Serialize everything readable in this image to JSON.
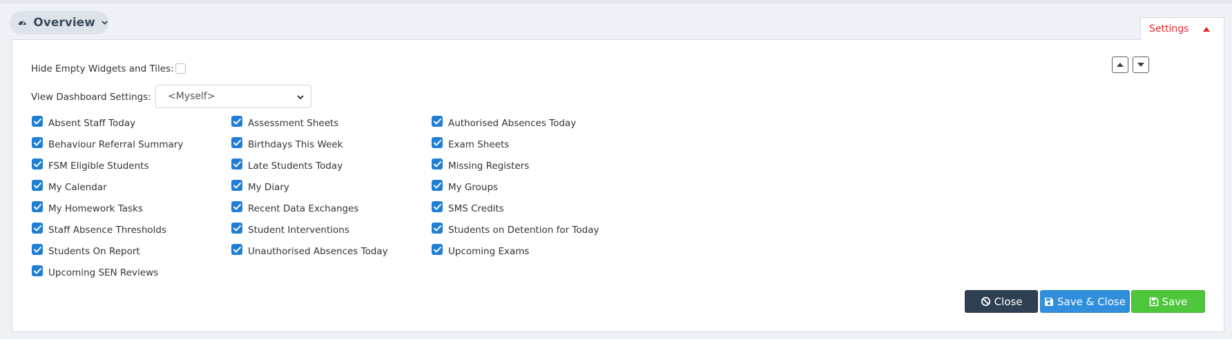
{
  "header": {
    "title": "Overview",
    "icons": {
      "dashboard": "gauge-icon",
      "dropdown": "chevron-down-icon"
    }
  },
  "toolbar": {
    "move_up_icon": "arrow-up-icon",
    "move_down_icon": "arrow-down-icon",
    "settings_tab_label": "Settings",
    "settings_tab_color": "#e8242b"
  },
  "settings": {
    "hide_empty_label": "Hide Empty Widgets and Tiles:",
    "hide_empty_checked": false,
    "view_dashboard_label": "View Dashboard Settings:",
    "view_dashboard_value": "<Myself>",
    "check_color": "#1f7fd6",
    "widgets": [
      {
        "label": "Absent Staff Today",
        "checked": true
      },
      {
        "label": "Behaviour Referral Summary",
        "checked": true
      },
      {
        "label": "FSM Eligible Students",
        "checked": true
      },
      {
        "label": "My Calendar",
        "checked": true
      },
      {
        "label": "My Homework Tasks",
        "checked": true
      },
      {
        "label": "Staff Absence Thresholds",
        "checked": true
      },
      {
        "label": "Students On Report",
        "checked": true
      },
      {
        "label": "Upcoming SEN Reviews",
        "checked": true
      },
      {
        "label": "Assessment Sheets",
        "checked": true
      },
      {
        "label": "Birthdays This Week",
        "checked": true
      },
      {
        "label": "Late Students Today",
        "checked": true
      },
      {
        "label": "My Diary",
        "checked": true
      },
      {
        "label": "Recent Data Exchanges",
        "checked": true
      },
      {
        "label": "Student Interventions",
        "checked": true
      },
      {
        "label": "Unauthorised Absences Today",
        "checked": true
      },
      {
        "label": "Authorised Absences Today",
        "checked": true
      },
      {
        "label": "Exam Sheets",
        "checked": true
      },
      {
        "label": "Missing Registers",
        "checked": true
      },
      {
        "label": "My Groups",
        "checked": true
      },
      {
        "label": "SMS Credits",
        "checked": true
      },
      {
        "label": "Students on Detention for Today",
        "checked": true
      },
      {
        "label": "Upcoming Exams",
        "checked": true
      }
    ]
  },
  "actions": {
    "close_label": "Close",
    "close_icon": "ban-icon",
    "save_close_label": "Save & Close",
    "save_close_icon": "floppy-disk-icon",
    "save_label": "Save",
    "save_icon": "floppy-disk-outline-icon",
    "colors": {
      "close": "#2f4052",
      "save_close": "#2f8fdc",
      "save": "#4fc73d"
    }
  }
}
